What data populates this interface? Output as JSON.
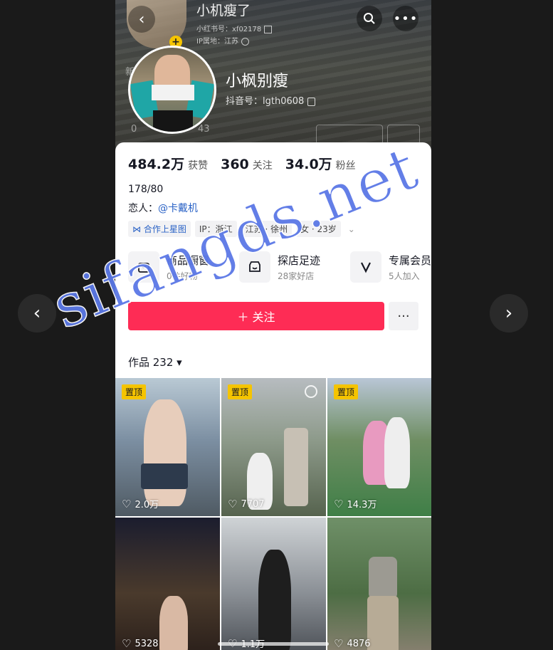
{
  "header": {
    "ghost_name": "小机瘦了",
    "ghost_id": "小红书号：xf02178",
    "ghost_ip": "IP属地：江苏",
    "ghost_left_1": "新",
    "ghost_left_2": "0",
    "ghost_left_3": "43"
  },
  "profile": {
    "name": "小枫别瘦",
    "douyin_id": "抖音号：lgth0608"
  },
  "stats": [
    {
      "num": "484.2万",
      "label": "获赞"
    },
    {
      "num": "360",
      "label": "关注"
    },
    {
      "num": "34.0万",
      "label": "粉丝"
    }
  ],
  "bio": {
    "line1": "178/80",
    "lover_prefix": "恋人：",
    "lover_mention": "@卡戴机"
  },
  "tags": {
    "coop": "合作上星图",
    "ip": "IP：浙江",
    "location": "江苏 · 徐州",
    "gender_age": "女 · 23岁",
    "expand": "⌄"
  },
  "services": [
    {
      "title": "商品橱窗",
      "sub": "0件好物",
      "icon": "bag-icon"
    },
    {
      "title": "探店足迹",
      "sub": "28家好店",
      "icon": "shop-icon"
    },
    {
      "title": "专属会员",
      "sub": "5人加入",
      "icon": "v-icon"
    }
  ],
  "actions": {
    "follow": "＋ 关注",
    "more": "···"
  },
  "works": {
    "tab_label": "作品 232 ▾"
  },
  "videos": [
    {
      "pinned": "置顶",
      "likes": "2.0万"
    },
    {
      "pinned": "置顶",
      "likes": "7707"
    },
    {
      "pinned": "置顶",
      "likes": "14.3万"
    },
    {
      "pinned": "",
      "likes": "5328"
    },
    {
      "pinned": "",
      "likes": "1.1万"
    },
    {
      "pinned": "",
      "likes": "4876"
    }
  ],
  "nav": {
    "prev": "‹",
    "next": "›"
  },
  "watermark": "sifangds.net"
}
